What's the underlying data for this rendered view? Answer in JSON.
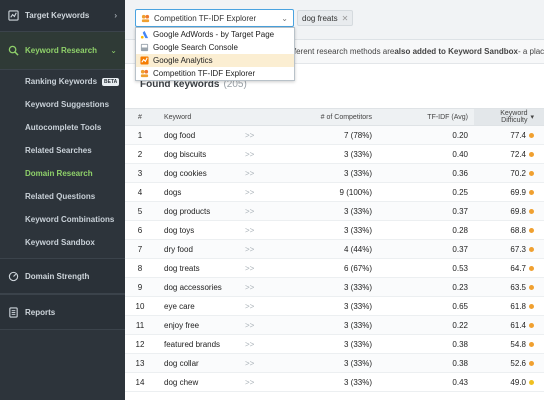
{
  "sidebar": {
    "target_keywords": "Target Keywords",
    "keyword_research": "Keyword Research",
    "items": [
      {
        "label": "Ranking Keywords",
        "badge": "BETA"
      },
      {
        "label": "Keyword Suggestions"
      },
      {
        "label": "Autocomplete Tools"
      },
      {
        "label": "Related Searches"
      },
      {
        "label": "Domain Research"
      },
      {
        "label": "Related Questions"
      },
      {
        "label": "Keyword Combinations"
      },
      {
        "label": "Keyword Sandbox"
      }
    ],
    "domain_strength": "Domain Strength",
    "reports": "Reports"
  },
  "topbar": {
    "selected_source": "Competition TF-IDF Explorer",
    "tag": "dog freats"
  },
  "dropdown": {
    "items": [
      {
        "label": "Google AdWords - by Target Page",
        "icon": "adwords-icon"
      },
      {
        "label": "Google Search Console",
        "icon": "search-console-icon"
      },
      {
        "label": "Google Analytics",
        "icon": "analytics-icon"
      },
      {
        "label": "Competition TF-IDF Explorer",
        "icon": "tfidf-icon"
      }
    ]
  },
  "info": {
    "text_before": "ifferent research methods are ",
    "text_bold": "also added to Keyword Sandbox",
    "text_after": " - a plac"
  },
  "found": {
    "title": "Found keywords",
    "count": "(205)"
  },
  "table": {
    "headers": {
      "num": "#",
      "keyword": "Keyword",
      "competitors": "# of Competitors",
      "tfidf": "TF-IDF (Avg)",
      "difficulty": "Keyword Difficulty"
    },
    "rows": [
      {
        "n": "1",
        "kw": "dog food",
        "comp": "7 (78%)",
        "tfidf": "0.20",
        "diff": "77.4"
      },
      {
        "n": "2",
        "kw": "dog biscuits",
        "comp": "3 (33%)",
        "tfidf": "0.40",
        "diff": "72.4"
      },
      {
        "n": "3",
        "kw": "dog cookies",
        "comp": "3 (33%)",
        "tfidf": "0.36",
        "diff": "70.2"
      },
      {
        "n": "4",
        "kw": "dogs",
        "comp": "9 (100%)",
        "tfidf": "0.25",
        "diff": "69.9"
      },
      {
        "n": "5",
        "kw": "dog products",
        "comp": "3 (33%)",
        "tfidf": "0.37",
        "diff": "69.8"
      },
      {
        "n": "6",
        "kw": "dog toys",
        "comp": "3 (33%)",
        "tfidf": "0.28",
        "diff": "68.8"
      },
      {
        "n": "7",
        "kw": "dry food",
        "comp": "4 (44%)",
        "tfidf": "0.37",
        "diff": "67.3"
      },
      {
        "n": "8",
        "kw": "dog treats",
        "comp": "6 (67%)",
        "tfidf": "0.53",
        "diff": "64.7"
      },
      {
        "n": "9",
        "kw": "dog accessories",
        "comp": "3 (33%)",
        "tfidf": "0.23",
        "diff": "63.5"
      },
      {
        "n": "10",
        "kw": "eye care",
        "comp": "3 (33%)",
        "tfidf": "0.65",
        "diff": "61.8"
      },
      {
        "n": "11",
        "kw": "enjoy free",
        "comp": "3 (33%)",
        "tfidf": "0.22",
        "diff": "61.4"
      },
      {
        "n": "12",
        "kw": "featured brands",
        "comp": "3 (33%)",
        "tfidf": "0.38",
        "diff": "54.8"
      },
      {
        "n": "13",
        "kw": "dog collar",
        "comp": "3 (33%)",
        "tfidf": "0.38",
        "diff": "52.6"
      },
      {
        "n": "14",
        "kw": "dog chew",
        "comp": "3 (33%)",
        "tfidf": "0.43",
        "diff": "49.0"
      }
    ]
  },
  "colors": {
    "sidebar_bg": "#2d343b",
    "accent_green": "#8fd16a",
    "difficulty_dot": "#f0a030"
  }
}
